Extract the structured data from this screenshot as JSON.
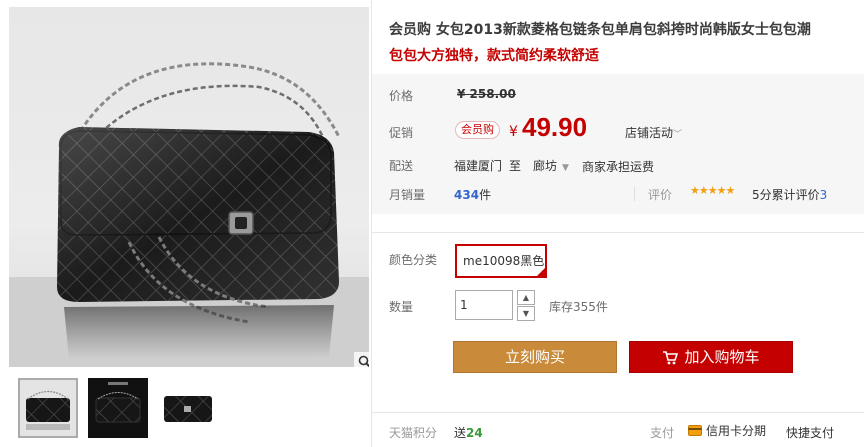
{
  "product": {
    "title": "会员购 女包2013新款菱格包链条包单肩包斜挎时尚韩版女士包包潮",
    "subtitle": "包包大方独特，款式简约柔软舒适"
  },
  "price": {
    "label": "价格",
    "original": "¥ 258.00",
    "promo_label": "促销",
    "promo_tag": "会员购",
    "currency": "¥",
    "current": "49.90",
    "store_promo": "店铺活动"
  },
  "shipping": {
    "label": "配送",
    "from": "福建厦门",
    "to": "至",
    "destination": "廊坊",
    "fee": "商家承担运费"
  },
  "sales": {
    "label": "月销量",
    "count": "434",
    "unit": "件",
    "review_label": "评价",
    "stars": "★★★★★",
    "rating_text": "5分累计评价",
    "review_count": "3",
    "rating_value": 5
  },
  "sku": {
    "color_label": "颜色分类",
    "color_selected": "me10098黑色",
    "qty_label": "数量",
    "qty_value": "1",
    "stock": "库存355件"
  },
  "actions": {
    "buy_now": "立刻购买",
    "add_cart": "加入购物车"
  },
  "bottom": {
    "points_label": "天猫积分",
    "points_prefix": "送",
    "points_value": "24",
    "pay_label": "支付",
    "card_installment": "信用卡分期",
    "quick_pay": "快捷支付"
  },
  "colors": {
    "accent_red": "#c40000",
    "buy_orange": "#c98a3a",
    "link_blue": "#3366cc"
  }
}
